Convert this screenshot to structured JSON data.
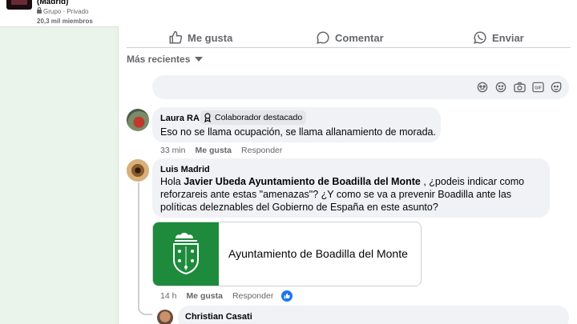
{
  "group": {
    "name": "(Madrid)",
    "type": "Grupo · Privado",
    "members": "20,3 mil miembros"
  },
  "actions": {
    "like": "Me gusta",
    "comment": "Comentar",
    "send": "Enviar"
  },
  "sort": {
    "label": "Más recientes"
  },
  "comment_input": {
    "icons": [
      "avatar-sticker-icon",
      "emoji-icon",
      "camera-icon",
      "gif-icon",
      "sticker-icon"
    ]
  },
  "comments": [
    {
      "author": "Laura RA",
      "badge": "Colaborador destacado",
      "text": "Eso no se llama ocupación, se llama allanamiento de morada.",
      "time": "33 min",
      "like": "Me gusta",
      "reply": "Responder"
    },
    {
      "author": "Luis Madrid",
      "text_line1_pre": "Hola ",
      "text_line1_mention": "Javier Ubeda Ayuntamiento de Boadilla del Monte",
      "text_line1_post": " , ¿podeis indicar como",
      "text_line2": "reforzareis ante estas \"amenazas\"? ¿Y como se va a prevenir Boadilla ante las",
      "text_line3": "políticas deleznables del Gobierno de España en este asunto?",
      "link_card": {
        "title": "Ayuntamiento de Boadilla del Monte"
      },
      "time": "14 h",
      "like": "Me gusta",
      "reply": "Responder",
      "reactions": "like"
    },
    {
      "author": "Christian Casati"
    }
  ],
  "colors": {
    "accent": "#1877f2",
    "sidebar_bg": "#eaf4ea",
    "bubble_bg": "#f0f2f5",
    "card_green": "#1e8a3c"
  }
}
